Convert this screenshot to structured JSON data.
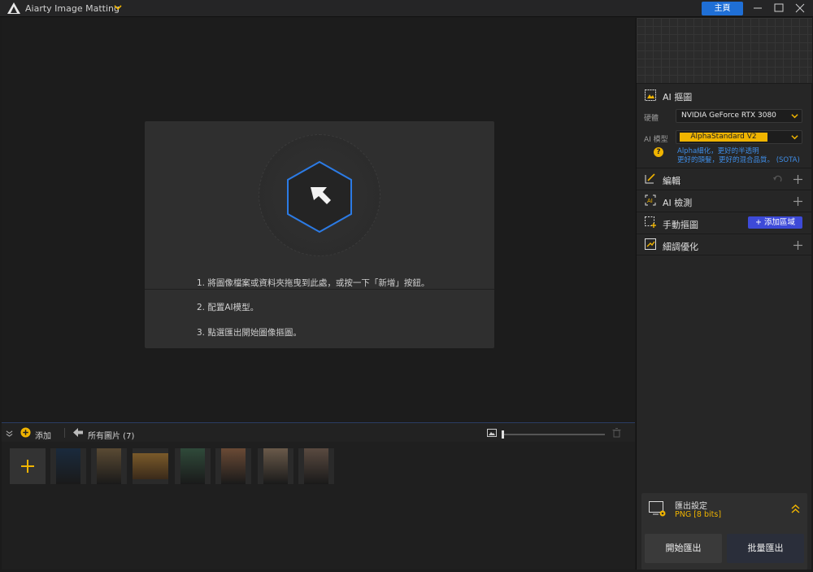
{
  "titlebar": {
    "app_name": "Aiarty Image Matting",
    "home_label": "主頁"
  },
  "drop_card": {
    "steps": [
      "1. 將圖像檔案或資料夾拖曳到此處，或按一下「新增」按鈕。",
      "2. 配置AI模型。",
      "3. 點選匯出開始圖像摳圖。"
    ]
  },
  "bottombar": {
    "add_label": "添加",
    "all_images_label": "所有圖片 (7)"
  },
  "thumbnails": [
    {
      "name": "jellyfish",
      "color": "#1a2a3d"
    },
    {
      "name": "dragon",
      "color": "#5a4a33"
    },
    {
      "name": "bicycle",
      "color": "#7a5a2a"
    },
    {
      "name": "woman-red-dress-forest",
      "color": "#2f4a3a"
    },
    {
      "name": "woman-flowers-1",
      "color": "#6a4a35"
    },
    {
      "name": "woman-flowers-2",
      "color": "#6a5a4a"
    },
    {
      "name": "woman-flowers-3",
      "color": "#5a4a40"
    }
  ],
  "sidebar": {
    "ai_matting_title": "AI 摳圖",
    "gpu_label": "硬體",
    "gpu_value": "NVIDIA GeForce RTX 3080",
    "model_label": "AI 模型",
    "model_value": "AlphaStandard  V2",
    "model_note_1": "Alpha細化，更好的半透明",
    "model_note_2": "更好的頭髮，更好的混合品質。 (SOTA)",
    "edit_title": "編輯",
    "ai_detect_title": "AI 檢測",
    "manual_matting_title": "手動摳圖",
    "add_region_label": "+ 添加區域",
    "refine_title": "細調優化"
  },
  "export": {
    "title": "匯出設定",
    "format": "PNG  [8 bits]",
    "btn_left": "開始匯出",
    "btn_right": "批量匯出"
  },
  "colors": {
    "accent_blue": "#1f6fd6",
    "accent_yellow": "#f0b400",
    "add_region_blue": "#3d4ad8"
  }
}
